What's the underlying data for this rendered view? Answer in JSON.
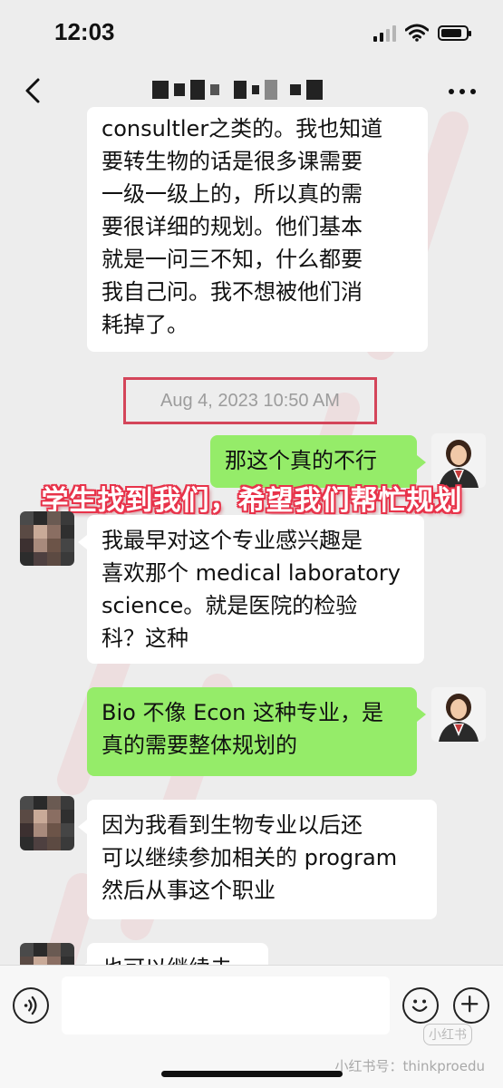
{
  "status_bar": {
    "time": "12:03"
  },
  "messages": [
    {
      "side": "in",
      "lines": [
        "consultler之类的。我也知道",
        "要转生物的话是很多课需要",
        "一级一级上的，所以真的需",
        "要很详细的规划。他们基本",
        "就是一问三不知，什么都要",
        "我自己问。我不想被他们消",
        "耗掉了。"
      ]
    },
    {
      "side": "out",
      "lines": [
        "那这个真的不行"
      ]
    },
    {
      "side": "in",
      "lines": [
        "我最早对这个专业感兴趣是",
        "喜欢那个 medical laboratory",
        "science。就是医院的检验",
        "科？这种"
      ]
    },
    {
      "side": "out",
      "lines": [
        "Bio 不像 Econ 这种专业，是",
        "真的需要整体规划的"
      ]
    },
    {
      "side": "in",
      "lines": [
        "因为我看到生物专业以后还",
        "可以继续参加相关的 program",
        "然后从事这个职业"
      ]
    },
    {
      "side": "in",
      "lines": [
        "也可以继续去"
      ]
    }
  ],
  "timestamp": "Aug 4, 2023 10:50 AM",
  "overlay_banner": "学生找到我们，希望我们帮忙规划",
  "input_bar": {
    "placeholder": ""
  },
  "watermark": {
    "logo": "小红书",
    "text": "小红书号：thinkproedu"
  },
  "colors": {
    "background": "#ededed",
    "incoming_bubble": "#ffffff",
    "outgoing_bubble": "#95ec69",
    "timestamp_box": "#d4455a",
    "banner_stroke": "#e8334a"
  },
  "icons": [
    "back-icon",
    "more-icon",
    "voice-icon",
    "emoji-icon",
    "plus-icon",
    "signal-icon",
    "wifi-icon",
    "battery-icon"
  ]
}
